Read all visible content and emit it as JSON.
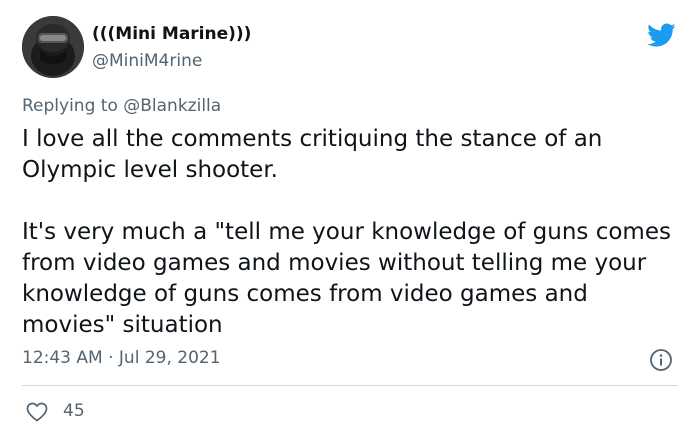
{
  "tweet": {
    "author": {
      "display_name": "(((Mini Marine)))",
      "handle": "@MiniM4rine"
    },
    "reply_context": {
      "prefix": "Replying to",
      "mention": "@Blankzilla"
    },
    "paragraphs": [
      "I love all the comments critiquing the stance of an Olympic level shooter.",
      "It's very much a \"tell me your knowledge of guns comes from video games and movies without telling me your knowledge of guns comes from video games and movies\" situation"
    ],
    "timestamp": "12:43 AM · Jul 29, 2021",
    "likes": "45"
  },
  "icons": {
    "brand": "twitter-bird-icon",
    "info": "info-icon",
    "like": "heart-icon"
  },
  "colors": {
    "brand_blue": "#1d9bf0",
    "text_primary": "#0f1419",
    "text_secondary": "#536471",
    "divider": "#cfd9de"
  }
}
